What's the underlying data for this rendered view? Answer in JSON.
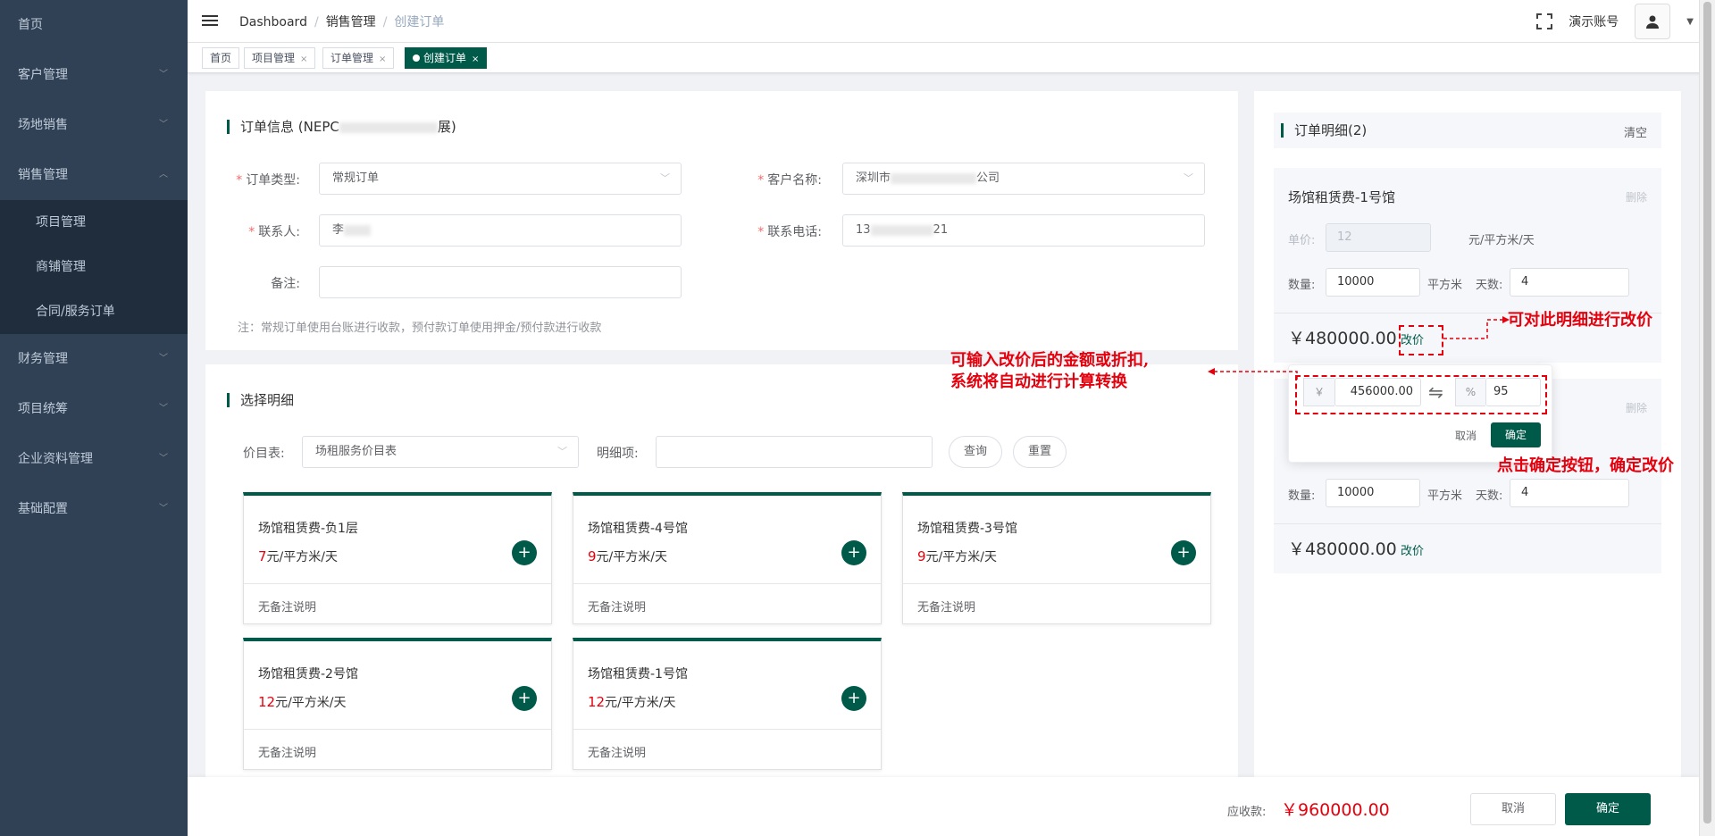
{
  "sidebar": {
    "items": [
      {
        "label": "首页"
      },
      {
        "label": "客户管理"
      },
      {
        "label": "场地销售"
      },
      {
        "label": "销售管理"
      },
      {
        "label": "财务管理"
      },
      {
        "label": "项目统筹"
      },
      {
        "label": "企业资料管理"
      },
      {
        "label": "基础配置"
      }
    ],
    "sub_items": [
      {
        "label": "项目管理"
      },
      {
        "label": "商铺管理"
      },
      {
        "label": "合同/服务订单"
      }
    ]
  },
  "navbar": {
    "breadcrumb": [
      "Dashboard",
      "销售管理",
      "创建订单"
    ],
    "account": "演示账号"
  },
  "tags": [
    {
      "label": "首页"
    },
    {
      "label": "项目管理"
    },
    {
      "label": "订单管理"
    },
    {
      "label": "创建订单"
    }
  ],
  "order_info": {
    "title_prefix": "订单信息 (NEPC",
    "title_suffix": "展)",
    "order_type_label": "订单类型:",
    "order_type_value": "常规订单",
    "customer_label": "客户名称:",
    "customer_prefix": "深圳市",
    "customer_suffix": "公司",
    "contact_label": "联系人:",
    "contact_prefix": "李",
    "phone_label": "联系电话:",
    "phone_prefix": "13",
    "phone_suffix": "21",
    "remark_label": "备注:",
    "note": "注：常规订单使用台账进行收款，预付款订单使用押金/预付款进行收款"
  },
  "select_detail": {
    "title": "选择明细",
    "price_list_label": "价目表:",
    "price_list_value": "场租服务价目表",
    "detail_label": "明细项:",
    "query_btn": "查询",
    "reset_btn": "重置",
    "cards": [
      {
        "name": "场馆租赁费-负1层",
        "price": "7",
        "unit": "元/平方米/天",
        "remark": "无备注说明"
      },
      {
        "name": "场馆租赁费-4号馆",
        "price": "9",
        "unit": "元/平方米/天",
        "remark": "无备注说明"
      },
      {
        "name": "场馆租赁费-3号馆",
        "price": "9",
        "unit": "元/平方米/天",
        "remark": "无备注说明"
      },
      {
        "name": "场馆租赁费-2号馆",
        "price": "12",
        "unit": "元/平方米/天",
        "remark": "无备注说明"
      },
      {
        "name": "场馆租赁费-1号馆",
        "price": "12",
        "unit": "元/平方米/天",
        "remark": "无备注说明"
      }
    ]
  },
  "order_detail": {
    "title": "订单明细(2)",
    "clear": "清空",
    "item1": {
      "name": "场馆租赁费-1号馆",
      "delete": "删除",
      "price_label": "单价:",
      "price": "12",
      "price_unit": "元/平方米/天",
      "qty_label": "数量:",
      "qty": "10000",
      "qty_unit": "平方米",
      "days_label": "天数:",
      "days": "4",
      "amount": "￥480000.00",
      "change_price": "改价"
    },
    "item2": {
      "delete": "删除",
      "qty_label": "数量:",
      "qty": "10000",
      "qty_unit": "平方米",
      "days_label": "天数:",
      "days": "4",
      "amount": "￥480000.00",
      "change_price": "改价"
    },
    "popover": {
      "currency": "￥",
      "amount": "456000.00",
      "swap": "⇋",
      "percent": "%",
      "discount": "95",
      "cancel": "取消",
      "confirm": "确定"
    }
  },
  "annotations": {
    "a1": "可对此明细进行改价",
    "a2_line1": "可输入改价后的金额或折扣,",
    "a2_line2": "系统将自动进行计算转换",
    "a3": "点击确定按钮，确定改价"
  },
  "footer": {
    "receivable_label": "应收款:",
    "receivable_value": "￥960000.00",
    "cancel": "取消",
    "confirm": "确定"
  },
  "colors": {
    "primary": "#005a4a",
    "sidebar": "#304156",
    "red": "#e5000d"
  }
}
